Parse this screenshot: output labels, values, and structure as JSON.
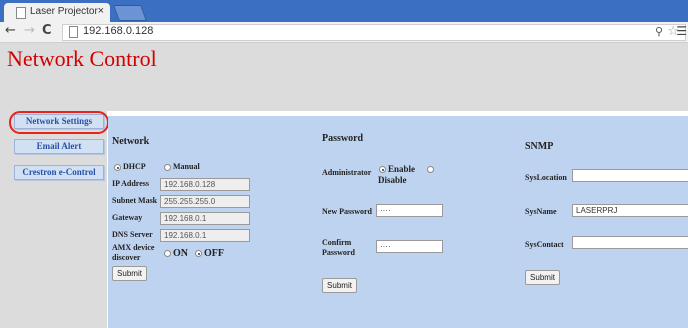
{
  "browser": {
    "tab_title": "Laser Projector",
    "tab_close": "×",
    "url": "192.168.0.128"
  },
  "page": {
    "title": "Network Control"
  },
  "sidebar": {
    "items": [
      {
        "label": "Network Settings"
      },
      {
        "label": "Email Alert"
      },
      {
        "label": "Crestron e-Control"
      }
    ]
  },
  "network": {
    "heading": "Network",
    "dhcp_label": "DHCP",
    "manual_label": "Manual",
    "ip_label": "IP Address",
    "ip_value": "192.168.0.128",
    "subnet_label": "Subnet Mask",
    "subnet_value": "255.255.255.0",
    "gateway_label": "Gateway",
    "gateway_value": "192.168.0.1",
    "dns_label": "DNS Server",
    "dns_value": "192.168.0.1",
    "amx_label_1": "AMX device",
    "amx_label_2": "discover",
    "on_label": "ON",
    "off_label": "OFF",
    "submit_label": "Submit"
  },
  "password": {
    "heading": "Password",
    "admin_label": "Administrator",
    "enable_label": "Enable",
    "disable_label": "Disable",
    "new_label": "New Password",
    "new_value": "····",
    "confirm_label_1": "Confirm",
    "confirm_label_2": "Password",
    "confirm_value": "····",
    "submit_label": "Submit"
  },
  "snmp": {
    "heading": "SNMP",
    "location_label": "SysLocation",
    "location_value": "",
    "name_label": "SysName",
    "name_value": "LASERPRJ",
    "contact_label": "SysContact",
    "contact_value": "",
    "submit_label": "Submit"
  }
}
